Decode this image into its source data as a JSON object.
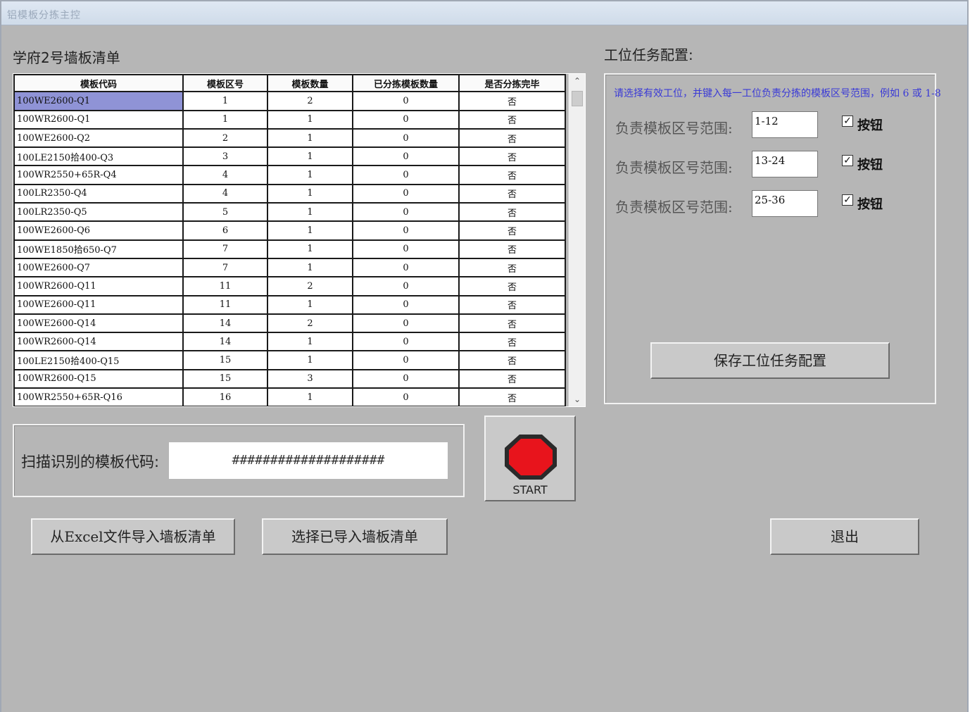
{
  "window": {
    "title": "铝模板分拣主控"
  },
  "list": {
    "caption": "学府2号墙板清单",
    "headers": [
      "模板代码",
      "模板区号",
      "模板数量",
      "已分拣模板数量",
      "是否分拣完毕"
    ],
    "rows": [
      {
        "code": "100WE2600-Q1",
        "zone": "1",
        "qty": "2",
        "sorted": "0",
        "done": "否"
      },
      {
        "code": "100WR2600-Q1",
        "zone": "1",
        "qty": "1",
        "sorted": "0",
        "done": "否"
      },
      {
        "code": "100WE2600-Q2",
        "zone": "2",
        "qty": "1",
        "sorted": "0",
        "done": "否"
      },
      {
        "code": "100LE2150拾400-Q3",
        "zone": "3",
        "qty": "1",
        "sorted": "0",
        "done": "否"
      },
      {
        "code": "100WR2550+65R-Q4",
        "zone": "4",
        "qty": "1",
        "sorted": "0",
        "done": "否"
      },
      {
        "code": "100LR2350-Q4",
        "zone": "4",
        "qty": "1",
        "sorted": "0",
        "done": "否"
      },
      {
        "code": "100LR2350-Q5",
        "zone": "5",
        "qty": "1",
        "sorted": "0",
        "done": "否"
      },
      {
        "code": "100WE2600-Q6",
        "zone": "6",
        "qty": "1",
        "sorted": "0",
        "done": "否"
      },
      {
        "code": "100WE1850拾650-Q7",
        "zone": "7",
        "qty": "1",
        "sorted": "0",
        "done": "否"
      },
      {
        "code": "100WE2600-Q7",
        "zone": "7",
        "qty": "1",
        "sorted": "0",
        "done": "否"
      },
      {
        "code": "100WR2600-Q11",
        "zone": "11",
        "qty": "2",
        "sorted": "0",
        "done": "否"
      },
      {
        "code": "100WE2600-Q11",
        "zone": "11",
        "qty": "1",
        "sorted": "0",
        "done": "否"
      },
      {
        "code": "100WE2600-Q14",
        "zone": "14",
        "qty": "2",
        "sorted": "0",
        "done": "否"
      },
      {
        "code": "100WR2600-Q14",
        "zone": "14",
        "qty": "1",
        "sorted": "0",
        "done": "否"
      },
      {
        "code": "100LE2150拾400-Q15",
        "zone": "15",
        "qty": "1",
        "sorted": "0",
        "done": "否"
      },
      {
        "code": "100WR2600-Q15",
        "zone": "15",
        "qty": "3",
        "sorted": "0",
        "done": "否"
      },
      {
        "code": "100WR2550+65R-Q16",
        "zone": "16",
        "qty": "1",
        "sorted": "0",
        "done": "否"
      }
    ]
  },
  "config": {
    "caption": "工位任务配置:",
    "hint": "请选择有效工位，并键入每一工位负责分拣的模板区号范围，例如 6 或 1-8",
    "range_label": "负责模板区号范围:",
    "checkbox_label": "按钮",
    "ranges": [
      "1-12",
      "13-24",
      "25-36"
    ],
    "save_button": "保存工位任务配置"
  },
  "scan": {
    "label": "扫描识别的模板代码:",
    "value": "####################"
  },
  "start_button": {
    "label": "START",
    "color": "#e8141c"
  },
  "buttons": {
    "import_excel": "从Excel文件导入墙板清单",
    "select_imported": "选择已导入墙板清单",
    "exit": "退出"
  }
}
